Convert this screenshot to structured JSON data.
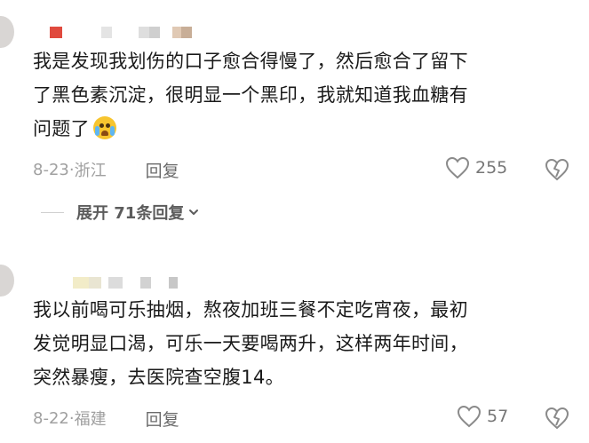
{
  "comments": [
    {
      "text_line1": "我是发现我划伤的口子愈合得慢了，然后愈合了留下",
      "text_line2": "了黑色素沉淀，很明显一个黑印，我就知道我血糖有",
      "text_line3": "问题了",
      "date": "8-23",
      "location": "浙江",
      "reply_label": "回复",
      "likes": "255",
      "like_icon": "heart-outline-icon",
      "dislike_icon": "broken-heart-icon"
    },
    {
      "text_line1": "我以前喝可乐抽烟，熬夜加班三餐不定吃宵夜，最初",
      "text_line2": "发觉明显口渴，可乐一天要喝两升，这样两年时间，",
      "text_line3": "突然暴瘦，去医院查空腹14。",
      "date": "8-22",
      "location": "福建",
      "reply_label": "回复",
      "likes": "57",
      "like_icon": "heart-outline-icon",
      "dislike_icon": "broken-heart-icon"
    }
  ],
  "expand_replies": {
    "label": "展开 71条回复",
    "icon": "chevron-down-icon"
  },
  "emoji": "crying-face-emoji",
  "colors": {
    "text": "#1a1a1a",
    "meta": "#9a9a9a",
    "reply": "#6b6b6b",
    "icon": "#8a8a8a"
  }
}
